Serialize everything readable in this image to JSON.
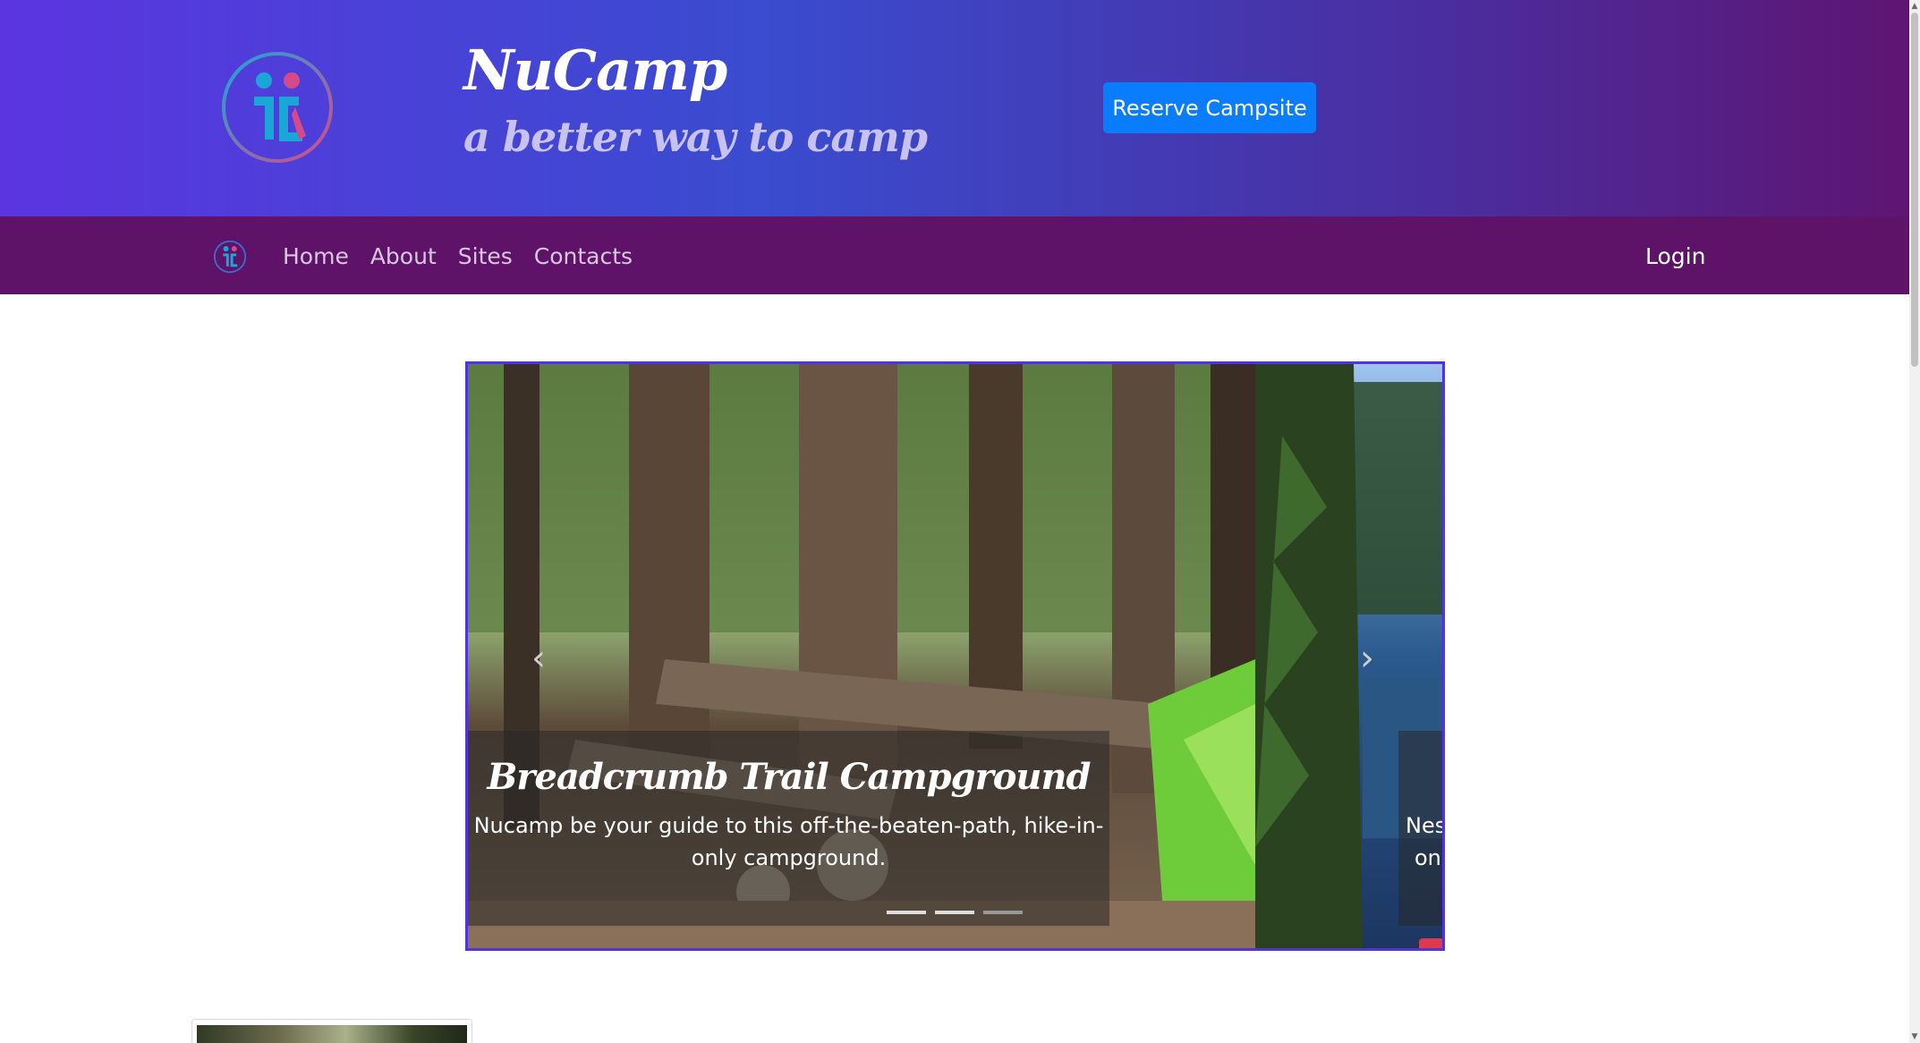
{
  "header": {
    "brand_title": "NuCamp",
    "brand_subtitle": "a better way to camp",
    "reserve_label": "Reserve Campsite"
  },
  "navbar": {
    "links": [
      "Home",
      "About",
      "Sites",
      "Contacts"
    ],
    "login_label": "Login"
  },
  "carousel": {
    "slides": [
      {
        "title": "Breadcrumb Trail Campground",
        "text": "Nucamp be your guide to this off-the-beaten-path, hike-in-only campground."
      },
      {
        "text_partial_line1": "Nes",
        "text_partial_line2": "on"
      }
    ],
    "indicator_count": 3,
    "active_indicator": 1
  },
  "colors": {
    "navbar_bg": "#5e1368",
    "reserve_button": "#0a7dfc",
    "carousel_border": "#4f35e0"
  },
  "icons": {
    "brand_logo": "nucamp-logo-icon",
    "prev": "chevron-left-icon",
    "next": "chevron-right-icon"
  }
}
